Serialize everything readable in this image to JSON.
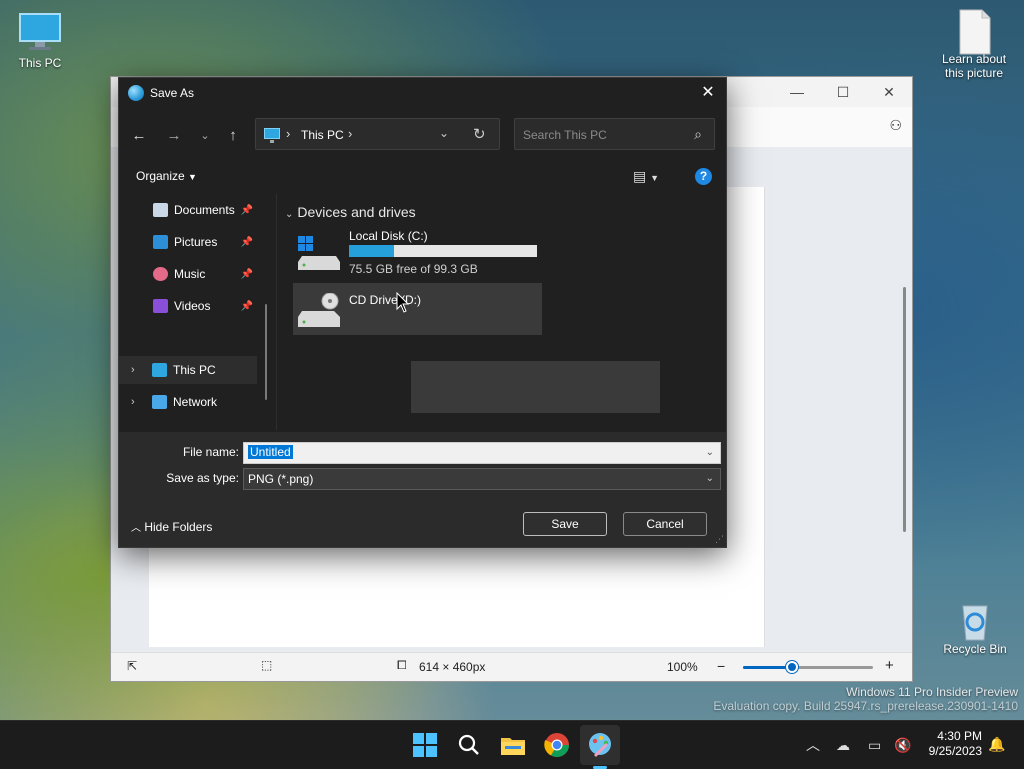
{
  "desktop": {
    "icons": {
      "this_pc": "This PC",
      "learn": "Learn about this picture",
      "recycle": "Recycle Bin"
    },
    "watermark": {
      "line1": "Windows 11 Pro Insider Preview",
      "line2": "Evaluation copy. Build 25947.rs_prerelease.230901-1410"
    }
  },
  "paint": {
    "statusbar": {
      "canvas_size": "614 × 460px",
      "zoom": "100%",
      "zoom_minus": "−",
      "zoom_plus": "+",
      "zoom_fraction": 0.38
    },
    "titlebar": {
      "minimize": "—",
      "maximize": "☐",
      "close": "✕"
    }
  },
  "dialog": {
    "title": "Save As",
    "address": {
      "location": "This PC"
    },
    "search_placeholder": "Search This PC",
    "organize": "Organize",
    "help": "?",
    "nav": [
      {
        "label": "Documents"
      },
      {
        "label": "Pictures"
      },
      {
        "label": "Music"
      },
      {
        "label": "Videos"
      },
      {
        "label": "This PC"
      },
      {
        "label": "Network"
      }
    ],
    "group_header": "Devices and drives",
    "drives": [
      {
        "name": "Local Disk (C:)",
        "free": "75.5 GB free of 99.3 GB",
        "used_fraction": 0.24
      },
      {
        "name": "CD Drive (D:)"
      }
    ],
    "file_name_label": "File name:",
    "file_name_value": "Untitled",
    "save_type_label": "Save as type:",
    "save_type_value": "PNG (*.png)",
    "hide_folders": "Hide Folders",
    "save": "Save",
    "cancel": "Cancel"
  },
  "taskbar": {
    "time": "4:30 PM",
    "date": "9/25/2023"
  }
}
